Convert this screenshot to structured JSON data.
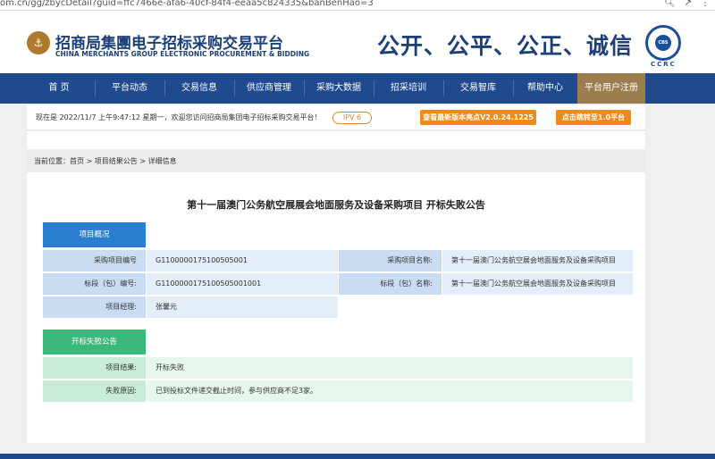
{
  "browser": {
    "url": "om.cn/gg/zbycDetail?guid=ffc7466e-afa6-40cf-84f4-eeaa5c824335&banBenHao=3"
  },
  "header": {
    "brand_cn": "招商局集團电子招标采购交易平台",
    "brand_en": "CHINA MERCHANTS GROUP ELECTRONIC PROCUREMENT & BIDDING",
    "slogan": "公开、公平、公正、诚信",
    "seal_core": "CBS",
    "seal_label": "CCRC"
  },
  "nav": {
    "items": [
      "首 页",
      "平台动态",
      "交易信息",
      "供应商管理",
      "采购大数据",
      "招采培训",
      "交易智库",
      "帮助中心",
      "平台用户注册"
    ]
  },
  "infobar": {
    "welcome": "现在是 2022/11/7 上午9:47:12 星期一，欢迎您访问招商局集团电子招标采购交易平台！",
    "ipv6": "IPV 6",
    "btn_new_version": "查看最新版本亮点V2.0.24.1225",
    "btn_switch": "点击跳转至1.0平台"
  },
  "breadcrumb": {
    "prefix": "当前位置：",
    "path": "首页 > 项目结果公告 > 详细信息"
  },
  "page": {
    "title": "第十一届澳门公务航空展展会地面服务及设备采购项目 开标失败公告"
  },
  "overview": {
    "heading": "项目概况",
    "rows": [
      {
        "l1": "采购项目编号",
        "v1": "G1100000175100505001",
        "l2": "采购项目名称:",
        "v2": "第十一届澳门公务航空展会地面服务及设备采购项目"
      },
      {
        "l1": "标段（包）编号:",
        "v1": "G1100000175100505001001",
        "l2": "标段（包）名称:",
        "v2": "第十一届澳门公务航空展会地面服务及设备采购项目"
      },
      {
        "l1": "项目经理:",
        "v1": "张馨元"
      }
    ]
  },
  "failure": {
    "heading": "开标失败公告",
    "rows": [
      {
        "label": "项目结果:",
        "value": "开标失败"
      },
      {
        "label": "失败原因:",
        "value": "已到投标文件递交截止时间，参与供应商不足3家。"
      }
    ]
  },
  "colors": {
    "nav_bg": "#1f4a8e",
    "nav_active": "#9c7d4e",
    "accent_orange": "#f08a1a",
    "section_blue": "#2b7fd1",
    "section_green": "#3cb87c"
  }
}
